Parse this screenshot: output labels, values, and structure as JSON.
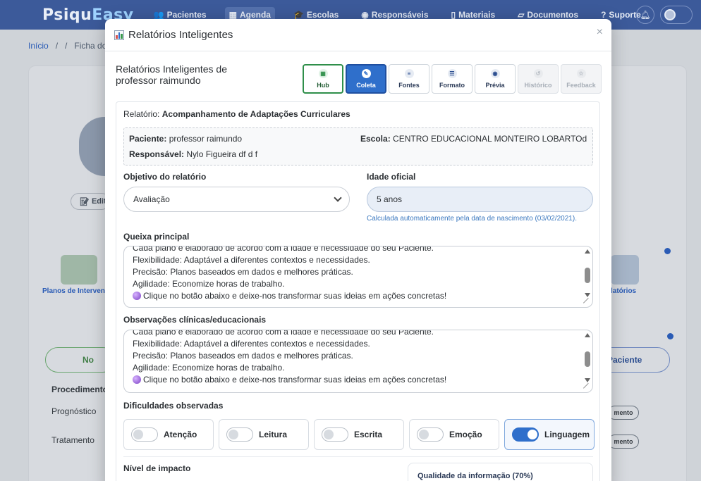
{
  "navbar": {
    "brand_a": "Psiqu",
    "brand_b": "Easy",
    "items": [
      {
        "label": "Pacientes",
        "icon": "users-icon"
      },
      {
        "label": "Agenda",
        "icon": "calendar-icon"
      },
      {
        "label": "Escolas",
        "icon": "school-icon"
      },
      {
        "label": "Responsáveis",
        "icon": "people-icon"
      },
      {
        "label": "Materiais",
        "icon": "file-icon"
      },
      {
        "label": "Documentos",
        "icon": "document-icon"
      },
      {
        "label": "Suporte",
        "icon": "help-icon"
      }
    ]
  },
  "background": {
    "breadcrumb_home": "Início",
    "breadcrumb_current": "Ficha do",
    "edit_label": "Edit",
    "plans_label": "Planos de Interven",
    "reports_label": "latórios",
    "new_button": "No",
    "patient_button": "Paciente",
    "table_header": "Procedimento",
    "rows": [
      "Prognóstico",
      "Tratamento"
    ],
    "pill_label": "mento"
  },
  "modal": {
    "title": "Relatórios Inteligentes",
    "close": "×",
    "subtitle": "Relatórios Inteligentes de professor raimundo",
    "steps": [
      {
        "label": "Hub",
        "icon": "grid-icon",
        "state": "done"
      },
      {
        "label": "Coleta",
        "icon": "edit-icon",
        "state": "current"
      },
      {
        "label": "Fontes",
        "icon": "database-icon",
        "state": "normal"
      },
      {
        "label": "Formato",
        "icon": "sliders-icon",
        "state": "normal"
      },
      {
        "label": "Prévia",
        "icon": "eye-icon",
        "state": "normal"
      },
      {
        "label": "Histórico",
        "icon": "history-icon",
        "state": "disabled"
      },
      {
        "label": "Feedback",
        "icon": "star-icon",
        "state": "disabled"
      }
    ],
    "report_prefix": "Relatório:",
    "report_name": "Acompanhamento de Adaptações Curriculares",
    "info": {
      "patient_label": "Paciente:",
      "patient_value": "professor raimundo",
      "school_label": "Escola:",
      "school_value": "CENTRO EDUCACIONAL MONTEIRO LOBARTOd",
      "guardian_label": "Responsável:",
      "guardian_value": "Nylo Figueira df d f"
    },
    "objective_label": "Objetivo do relatório",
    "objective_value": "Avaliação",
    "age_label": "Idade oficial",
    "age_value": "5 anos",
    "age_hint": "Calculada automaticamente pela data de nascimento (03/02/2021).",
    "complaint_label": "Queixa principal",
    "complaint_lines": [
      "Cada plano é elaborado de acordo com a idade e necessidade do seu Paciente.",
      "Flexibilidade: Adaptável a diferentes contextos e necessidades.",
      "Precisão: Planos baseados em dados e melhores práticas.",
      "Agilidade: Economize horas de trabalho.",
      "Clique no botão abaixo e deixe-nos transformar suas ideias em ações concretas!"
    ],
    "observations_label": "Observações clínicas/educacionais",
    "observations_lines": [
      "Cada plano é elaborado de acordo com a idade e necessidade do seu Paciente.",
      "Flexibilidade: Adaptável a diferentes contextos e necessidades.",
      "Precisão: Planos baseados em dados e melhores práticas.",
      "Agilidade: Economize horas de trabalho.",
      "Clique no botão abaixo e deixe-nos transformar suas ideias em ações concretas!"
    ],
    "difficulties_label": "Dificuldades observadas",
    "difficulties": [
      {
        "label": "Atenção",
        "on": false
      },
      {
        "label": "Leitura",
        "on": false
      },
      {
        "label": "Escrita",
        "on": false
      },
      {
        "label": "Emoção",
        "on": false
      },
      {
        "label": "Linguagem",
        "on": true
      }
    ],
    "impact_label": "Nível de impacto",
    "quality_label": "Qualidade da informação (70%)",
    "quality_percent": 70
  }
}
